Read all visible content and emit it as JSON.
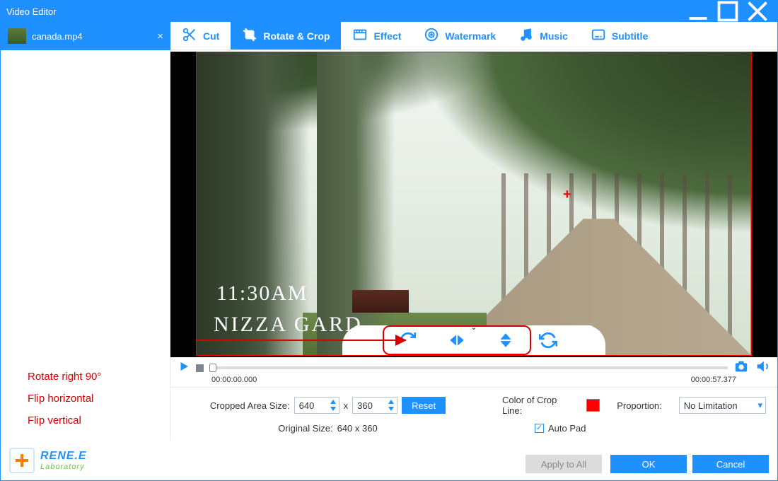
{
  "window": {
    "title": "Video Editor"
  },
  "file": {
    "name": "canada.mp4"
  },
  "tabs": {
    "cut": "Cut",
    "rotate_crop": "Rotate & Crop",
    "effect": "Effect",
    "watermark": "Watermark",
    "music": "Music",
    "subtitle": "Subtitle"
  },
  "annotations": {
    "rotate_right": "Rotate right 90°",
    "flip_h": "Flip horizontal",
    "flip_v": "Flip vertical"
  },
  "preview": {
    "time_overlay": "11:30AM",
    "place_overlay": "NIZZA GARD",
    "center_marker": "+"
  },
  "playbar": {
    "current_time": "00:00:00.000",
    "duration": "00:00:57.377"
  },
  "crop": {
    "label_cropped_area": "Cropped Area Size:",
    "width": "640",
    "sep": "x",
    "height": "360",
    "reset": "Reset",
    "label_original": "Original Size:",
    "original_value": "640 x 360",
    "label_color": "Color of Crop Line:",
    "color": "#ff0000",
    "label_proportion": "Proportion:",
    "proportion_value": "No Limitation",
    "auto_pad": "Auto Pad"
  },
  "footer": {
    "brand_line1": "RENE.E",
    "brand_line2": "Laboratory",
    "apply_all": "Apply to All",
    "ok": "OK",
    "cancel": "Cancel"
  }
}
